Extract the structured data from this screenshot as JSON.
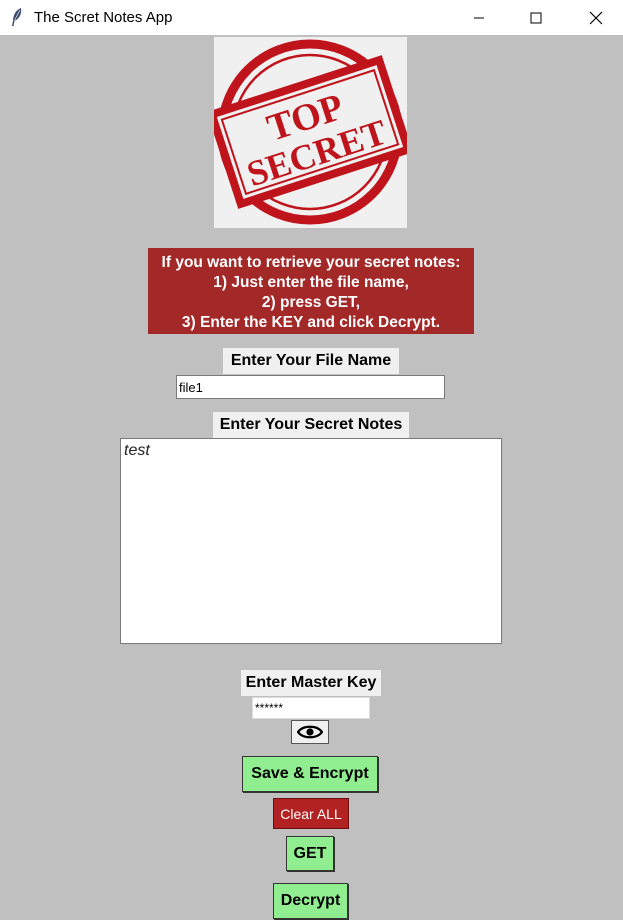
{
  "window": {
    "title": "The Scret Notes App",
    "icon": "feather-icon"
  },
  "logo": {
    "text_top": "TOP",
    "text_bottom": "SECRET",
    "color": "#c0141c"
  },
  "instructions": {
    "lines": [
      "If you want to retrieve your secret notes:",
      "1) Just enter the file name,",
      "2) press GET,",
      "3) Enter the KEY and click Decrypt."
    ]
  },
  "file": {
    "label": "Enter Your File Name",
    "value": "file1"
  },
  "notes": {
    "label": "Enter Your Secret Notes",
    "value": "test"
  },
  "master_key": {
    "label": "Enter Master Key",
    "value": "******"
  },
  "buttons": {
    "show_key_icon": "eye-icon",
    "save": "Save & Encrypt",
    "clear": "Clear ALL",
    "get": "GET",
    "decrypt": "Decrypt"
  },
  "colors": {
    "background": "#c0c0c0",
    "instructions_bg": "#a32828",
    "green_button": "#90ee90",
    "red_button": "#b22222"
  }
}
